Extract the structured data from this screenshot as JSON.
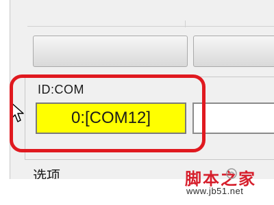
{
  "group": {
    "id_label": "ID:COM",
    "com_value": "0:[COM12]"
  },
  "options_label": "选项",
  "watermark": {
    "title": "脚本之家",
    "url": "www.jb51.net"
  },
  "colors": {
    "highlight": "#e0191f",
    "field_background": "#ffff00",
    "watermark": "#d61f2c"
  },
  "icons": [
    "mouse-cursor-icon",
    "watermark-logo-icon"
  ]
}
